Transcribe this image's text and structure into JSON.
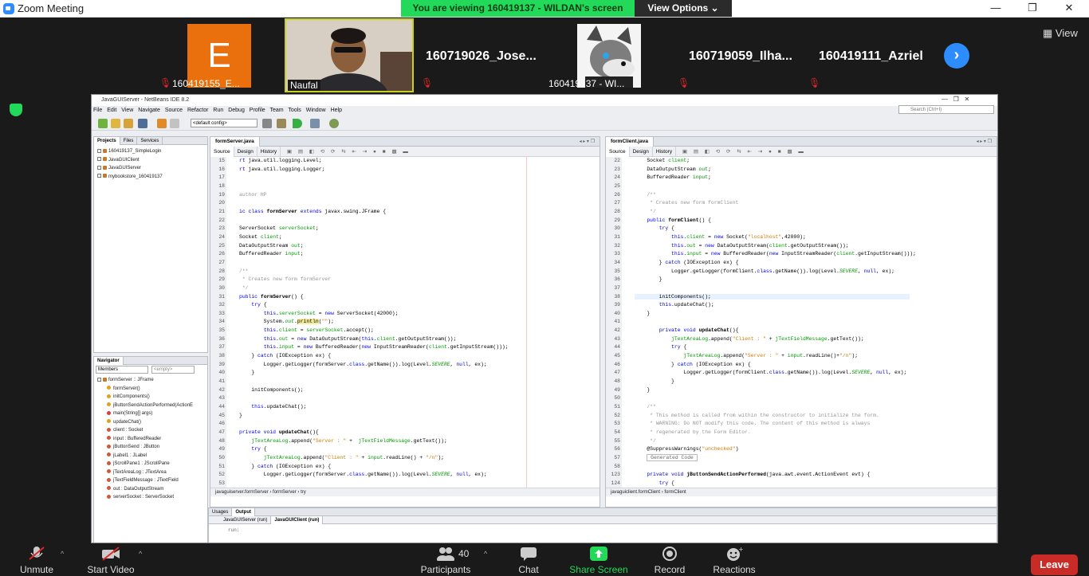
{
  "app": {
    "title": "Zoom Meeting",
    "banner": "You are viewing 160419137 - WILDAN's screen",
    "view_options": "View Options",
    "view_button": "View",
    "window_controls": [
      "—",
      "❐",
      "✕"
    ]
  },
  "gallery": [
    {
      "name": "160419155_E...",
      "avatar_letter": "E"
    },
    {
      "name": "Naufal"
    },
    {
      "name": "160719026_Jose..."
    },
    {
      "name": "160419137 - WI..."
    },
    {
      "name": "160719059_Ilha..."
    },
    {
      "name": "160419111_Azriel"
    }
  ],
  "netbeans": {
    "title": "JavaGUIServer - NetBeans IDE 8.2",
    "menu": [
      "File",
      "Edit",
      "View",
      "Navigate",
      "Source",
      "Refactor",
      "Run",
      "Debug",
      "Profile",
      "Team",
      "Tools",
      "Window",
      "Help"
    ],
    "search_placeholder": "Search (Ctrl+I)",
    "config": "<default config>",
    "project_tabs": [
      "Projects",
      "Files",
      "Services"
    ],
    "projects": [
      "160419137_SimpleLogin",
      "JavaGUIClient",
      "JavaGUIServer",
      "mybookstore_160419137"
    ],
    "navigator": {
      "title": "Navigator",
      "filter": "Members",
      "empty": "<empty>",
      "root": "formServer :: JFrame",
      "items": [
        "formServer()",
        "initComponents()",
        "jButtonSendActionPerformed(ActionE",
        "main(String[] args)",
        "updateChat()",
        "client : Socket",
        "input : BufferedReader",
        "jButtonSend : JButton",
        "jLabel1 : JLabel",
        "jScrollPane1 : JScrollPane",
        "jTextAreaLog : JTextArea",
        "jTextFieldMessage : JTextField",
        "out : DataOutputStream",
        "serverSocket : ServerSocket"
      ]
    },
    "left_editor": {
      "tab": "formServer.java",
      "modes": [
        "Source",
        "Design",
        "History"
      ],
      "breadcrumb": [
        "javaguiserver.formServer",
        "formServer",
        "try"
      ],
      "line_numbers": [
        15,
        16,
        17,
        18,
        19,
        20,
        21,
        22,
        23,
        24,
        25,
        26,
        27,
        28,
        29,
        30,
        31,
        32,
        33,
        34,
        35,
        36,
        37,
        38,
        39,
        40,
        41,
        42,
        43,
        44,
        45,
        46,
        47,
        48,
        49,
        50,
        51,
        52,
        53
      ]
    },
    "right_editor": {
      "tab": "formClient.java",
      "modes": [
        "Source",
        "Design",
        "History"
      ],
      "breadcrumb": [
        "javaguiclient.formClient",
        "formClient"
      ],
      "line_numbers": [
        22,
        23,
        24,
        25,
        26,
        27,
        28,
        29,
        30,
        31,
        32,
        33,
        34,
        35,
        36,
        37,
        38,
        39,
        40,
        41,
        42,
        43,
        44,
        45,
        46,
        47,
        48,
        49,
        50,
        51,
        52,
        53,
        54,
        55,
        56,
        57,
        58,
        123,
        124
      ]
    },
    "output": {
      "tabs": [
        "Usages",
        "Output"
      ],
      "run_tabs": [
        "JavaGUIServer (run)",
        "JavaGUIClient (run)"
      ],
      "text": "run:"
    }
  },
  "controls": {
    "unmute": "Unmute",
    "start_video": "Start Video",
    "participants": "Participants",
    "participants_count": "40",
    "chat": "Chat",
    "share_screen": "Share Screen",
    "record": "Record",
    "reactions": "Reactions",
    "leave": "Leave"
  },
  "colors": {
    "zoom_blue": "#2d8cff",
    "share_green": "#23d959",
    "leave_red": "#c92b27",
    "avatar_orange": "#e9700c"
  }
}
